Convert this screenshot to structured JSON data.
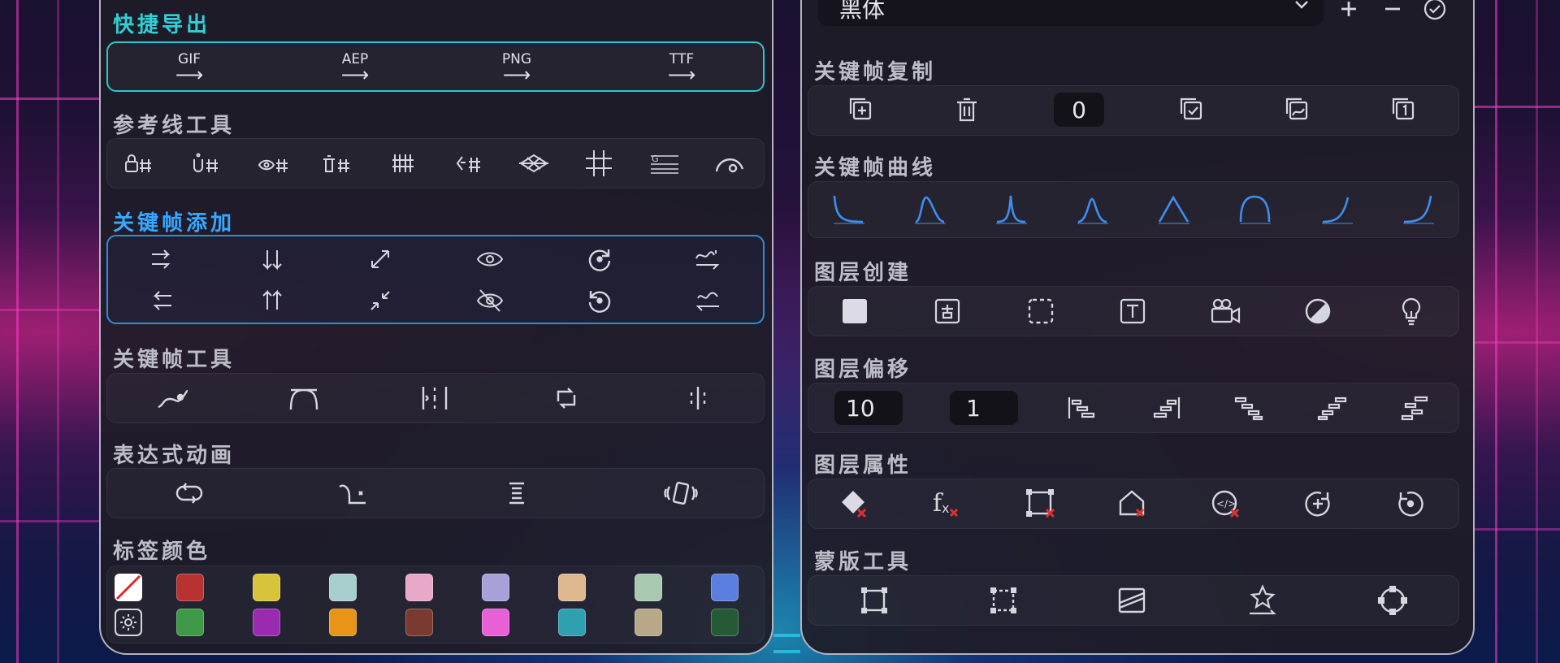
{
  "colors": {
    "accent_cyan": "#2fd0d6",
    "accent_blue": "#35a8ff",
    "curve_blue": "#3d8ef0"
  },
  "left": {
    "quick_export": {
      "title": "快捷导出",
      "items": [
        "GIF",
        "AEP",
        "PNG",
        "TTF"
      ]
    },
    "guide_tools": {
      "title": "参考线工具",
      "icons": [
        "lock-guides-icon",
        "unlock-guides-icon",
        "show-guides-icon",
        "delete-guides-icon",
        "guides-grid-icon",
        "code-guides-icon",
        "diamond-guides-icon",
        "grid-icon",
        "baseline-guide-icon",
        "arc-guide-icon"
      ]
    },
    "keyframe_add": {
      "title": "关键帧添加"
    },
    "keyframe_tools": {
      "title": "关键帧工具"
    },
    "expression_anim": {
      "title": "表达式动画"
    },
    "label_colors": {
      "title": "标签颜色",
      "swatches": [
        "none",
        "#b83232",
        "#d8c43a",
        "#a8cece",
        "#e8a8c8",
        "#a8a0d8",
        "#e0b890",
        "#a8c8b0",
        "#5a7ee0",
        "settings",
        "#3e9a48",
        "#9a2ab0",
        "#e89418",
        "#7a3a30",
        "#e860d8",
        "#2fa0b0",
        "#b8a888",
        "#245a34"
      ]
    }
  },
  "right": {
    "font_select": {
      "value": "黑体"
    },
    "keyframe_copy": {
      "title": "关键帧复制",
      "count": "0"
    },
    "keyframe_curve": {
      "title": "关键帧曲线"
    },
    "layer_create": {
      "title": "图层创建"
    },
    "layer_offset": {
      "title": "图层偏移",
      "value_a": "10",
      "value_b": "1"
    },
    "layer_props": {
      "title": "图层属性"
    },
    "mask_tools": {
      "title": "蒙版工具"
    }
  }
}
